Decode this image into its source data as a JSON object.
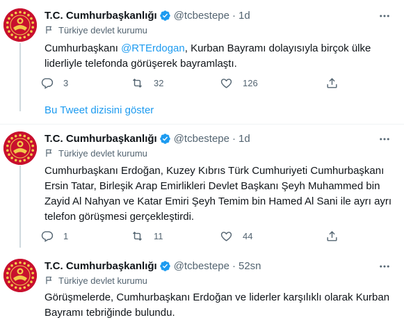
{
  "tweets": [
    {
      "name": "T.C. Cumhurbaşkanlığı",
      "handle": "@tcbestepe",
      "separator": "·",
      "time": "1d",
      "label": "Türkiye devlet kurumu",
      "text_before": "Cumhurbaşkanı ",
      "mention": "@RTErdogan",
      "text_after": ", Kurban Bayramı dolayısıyla birçok ülke liderliyle telefonda görüşerek bayramlaştı.",
      "replies": "3",
      "retweets": "32",
      "likes": "126"
    },
    {
      "name": "T.C. Cumhurbaşkanlığı",
      "handle": "@tcbestepe",
      "separator": "·",
      "time": "1d",
      "label": "Türkiye devlet kurumu",
      "text": "Cumhurbaşkanı Erdoğan, Kuzey Kıbrıs Türk Cumhuriyeti Cumhurbaşkanı Ersin Tatar, Birleşik Arap Emirlikleri Devlet Başkanı Şeyh Muhammed bin Zayid Al Nahyan ve Katar Emiri Şeyh Temim bin Hamed Al Sani ile ayrı ayrı telefon görüşmesi gerçekleştirdi.",
      "replies": "1",
      "retweets": "11",
      "likes": "44"
    },
    {
      "name": "T.C. Cumhurbaşkanlığı",
      "handle": "@tcbestepe",
      "separator": "·",
      "time": "52sn",
      "label": "Türkiye devlet kurumu",
      "text": "Görüşmelerde, Cumhurbaşkanı Erdoğan ve liderler karşılıklı olarak Kurban Bayramı tebriğinde bulundu."
    }
  ],
  "show_thread": "Bu Tweet dizisini göster",
  "colors": {
    "accent": "#1d9bf0",
    "avatar": "#c8102e",
    "muted": "#536471"
  },
  "icons": [
    "verified-badge-icon",
    "more-icon",
    "flag-icon",
    "reply-icon",
    "retweet-icon",
    "like-icon",
    "share-icon"
  ]
}
